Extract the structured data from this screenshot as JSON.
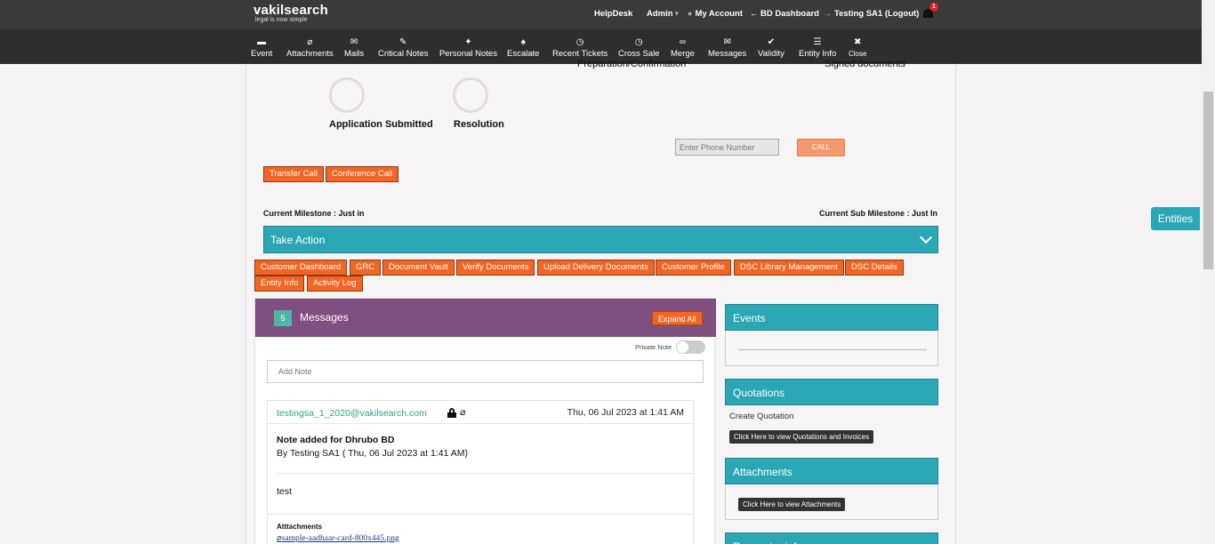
{
  "header": {
    "logo_main": "vakilsearch",
    "logo_tag": "legal is now simple",
    "links": {
      "helpdesk": "HelpDesk",
      "admin": "Admin",
      "my_account": "My Account",
      "bd_dashboard": "BD Dashboard",
      "user": "Testing SA1 (Logout)"
    },
    "notification_count": "1"
  },
  "toolbar": {
    "items": [
      {
        "label": "Event",
        "icon": "calendar-icon"
      },
      {
        "label": "Attachments",
        "icon": "paperclip-icon"
      },
      {
        "label": "Mails",
        "icon": "envelope-icon"
      },
      {
        "label": "Critical Notes",
        "icon": "pencil-icon"
      },
      {
        "label": "Personal Notes",
        "icon": "pin-icon"
      },
      {
        "label": "Escalate",
        "icon": "fire-icon"
      },
      {
        "label": "Recent Tickets",
        "icon": "clock-icon"
      },
      {
        "label": "Cross Sale",
        "icon": "clock-icon"
      },
      {
        "label": "Merge",
        "icon": "link-icon"
      },
      {
        "label": "Messages",
        "icon": "envelope-icon"
      },
      {
        "label": "Validity",
        "icon": "check-icon"
      },
      {
        "label": "Entity Info",
        "icon": "list-icon"
      },
      {
        "label": "Close",
        "icon": "close-icon"
      }
    ]
  },
  "progress": {
    "cut_left": "Preparation/Confirmation",
    "cut_right": "Signed documents",
    "milestones": [
      {
        "label": "Application Submitted"
      },
      {
        "label": "Resolution"
      }
    ]
  },
  "call": {
    "phone_placeholder": "Enter Phone Number",
    "call_label": "CALL",
    "transfer_label": "Transfer Call",
    "conference_label": "Conference Call"
  },
  "milestone": {
    "current": "Current Milestone : Just in",
    "current_sub": "Current Sub Milestone : Just In"
  },
  "take_action": {
    "label": "Take Action"
  },
  "action_buttons": {
    "customer_dashboard": "Customer Dashboard",
    "grc": "GRC",
    "document_vault": "Document Vault",
    "verify_documents": "Verify Documents",
    "upload_delivery": "Upload Delivery Documents",
    "customer_profile": "Customer Profile",
    "dsc_library": "DSC Library Management",
    "dsc_details": "DSC Details",
    "entity_info": "Entity Info",
    "activity_log": "Activity Log"
  },
  "messages": {
    "count": "5",
    "title": "Messages",
    "expand_label": "Expand All",
    "private_note_label": "Private Note",
    "add_note_placeholder": "Add Note",
    "item": {
      "email": "testingsa_1_2020@vakilsearch.com",
      "date": "Thu, 06 Jul 2023 at 1:41 AM",
      "title": "Note added for Dhrubo BD",
      "by": "By Testing SA1 ( Thu, 06 Jul 2023 at 1:41 AM)",
      "body": "test",
      "attachments_label": "Atttachments",
      "attachment_file": "sample-aadhaar-card-800x445.png"
    }
  },
  "side": {
    "events_title": "Events",
    "quotations_title": "Quotations",
    "create_quotation": "Create Quotation",
    "view_quotations": "Click Here to view Quotations and Invoices",
    "attachments_title": "Attachments",
    "view_attachments": "Click Here to view Attachments",
    "requester_title": "Requester info"
  },
  "entities_label": "Entities",
  "colors": {
    "teal": "#2aa6b5",
    "orange": "#f26522",
    "purple": "#7e4f80",
    "dark": "#2e2e2e"
  }
}
